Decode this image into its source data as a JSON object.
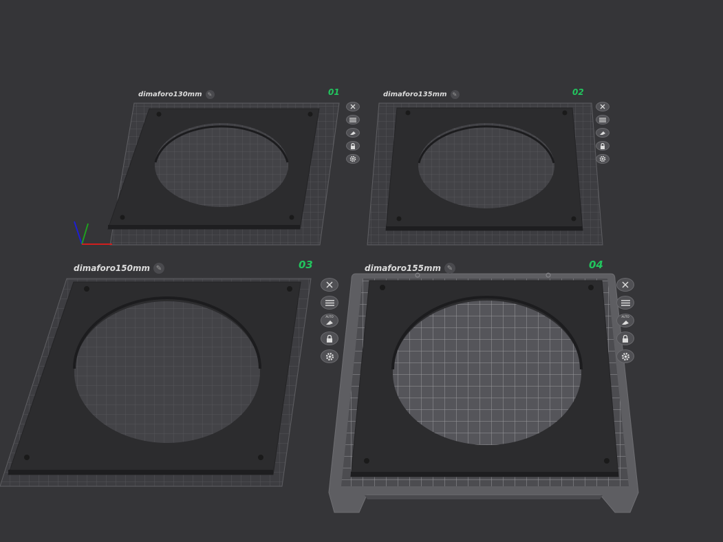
{
  "plates": [
    {
      "name": "dimaforo130mm",
      "number": "01",
      "selected": false
    },
    {
      "name": "dimaforo135mm",
      "number": "02",
      "selected": false
    },
    {
      "name": "dimaforo150mm",
      "number": "03",
      "selected": false
    },
    {
      "name": "dimaforo155mm",
      "number": "04",
      "selected": true
    }
  ],
  "plate_tools": [
    "close-icon",
    "arrange-list-icon",
    "auto-orient-icon",
    "lock-icon",
    "settings-gear-icon"
  ],
  "auto_badge": "AUTO",
  "colors": {
    "background": "#353538",
    "plate_number": "#22c55e",
    "part": "#2c2c2e",
    "selected_bed": "#5e5e62",
    "axis_x": "#d21e1e",
    "axis_y": "#1fa01f",
    "axis_z": "#1e1ed2"
  }
}
